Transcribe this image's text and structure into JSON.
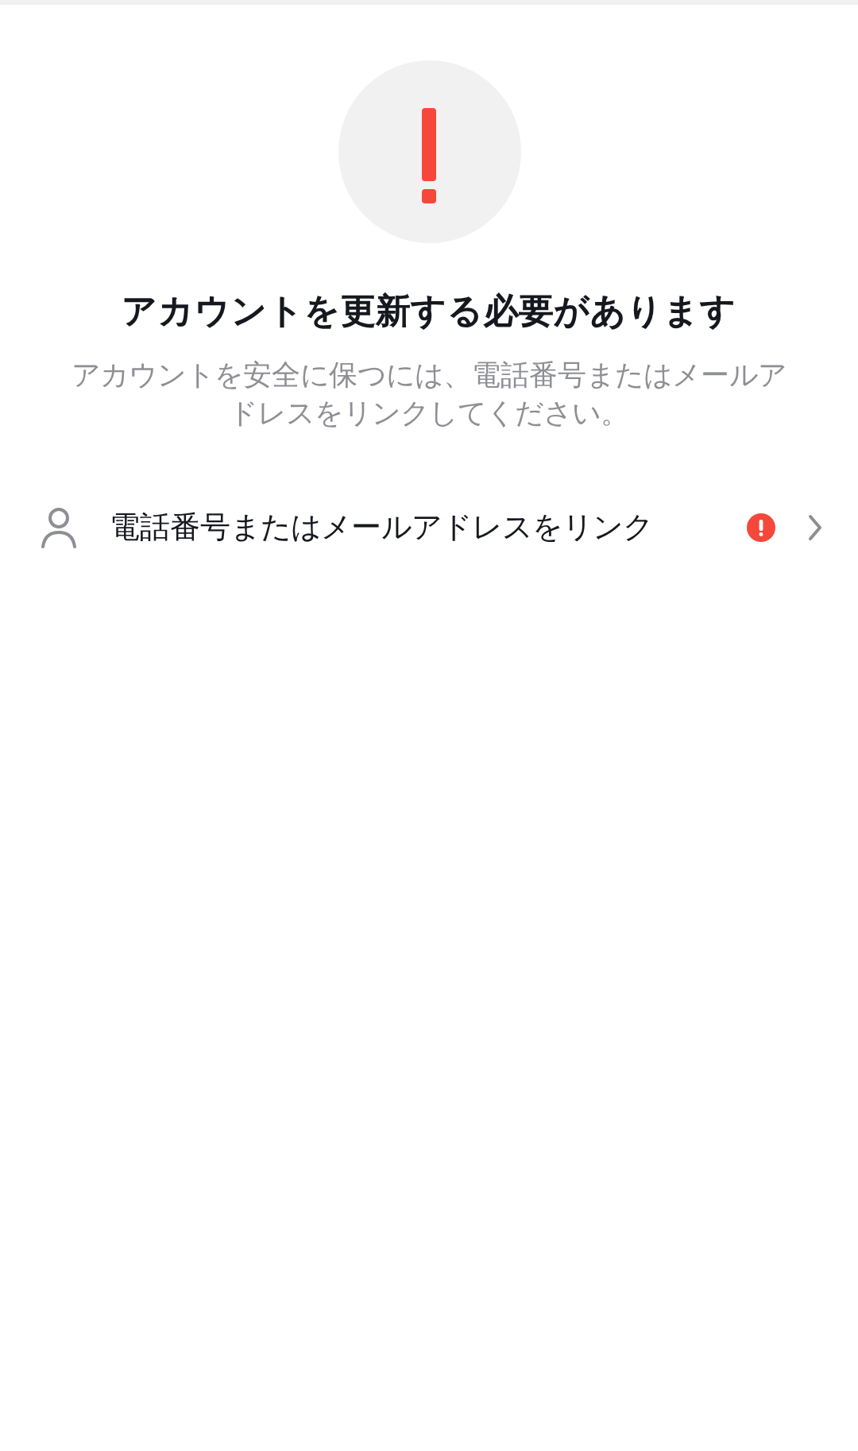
{
  "title": "アカウントを更新する必要があります",
  "description": "アカウントを安全に保つには、電話番号またはメールアドレスをリンクしてください。",
  "items": [
    {
      "label": "電話番号またはメールアドレスをリンク",
      "warning": true
    }
  ]
}
